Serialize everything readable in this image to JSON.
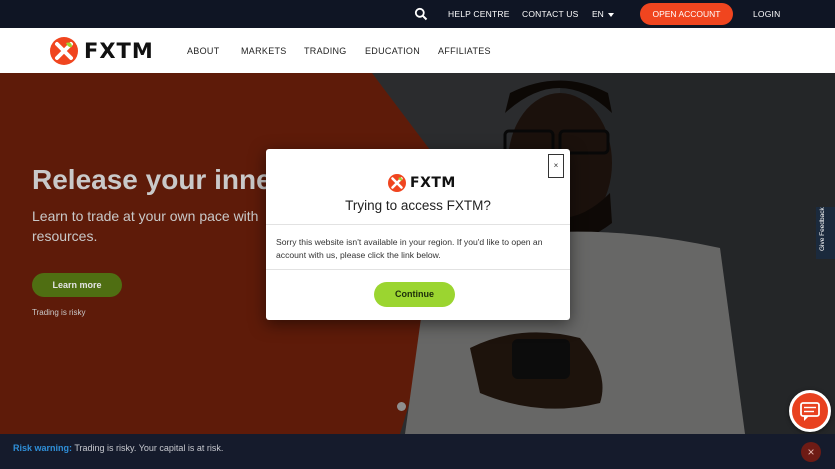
{
  "topbar": {
    "help": "HELP CENTRE",
    "contact": "CONTACT US",
    "language": "EN",
    "open_account": "OPEN ACCOUNT",
    "login": "LOGIN"
  },
  "brand": {
    "name": "FXTM"
  },
  "nav": [
    "ABOUT",
    "MARKETS",
    "TRADING",
    "EDUCATION",
    "AFFILIATES"
  ],
  "hero": {
    "title": "Release your inner",
    "subtitle": "Learn to trade at your own pace with resources.",
    "cta": "Learn more",
    "risk_note": "Trading is risky"
  },
  "feedback": {
    "label": "Give Feedback"
  },
  "modal": {
    "close": "×",
    "title": "Trying to access FXTM?",
    "body": "Sorry this website isn't available in your region. If you'd like to open an account with us, please click the link below.",
    "continue": "Continue"
  },
  "risk_bar": {
    "label": "Risk warning:",
    "text": "Trading is risky. Your capital is at risk.",
    "close": "×"
  },
  "colors": {
    "brand_orange": "#f0451f",
    "brand_green": "#9bd530",
    "topbar_bg": "#0f1524",
    "risk_label": "#2f8fd8"
  }
}
